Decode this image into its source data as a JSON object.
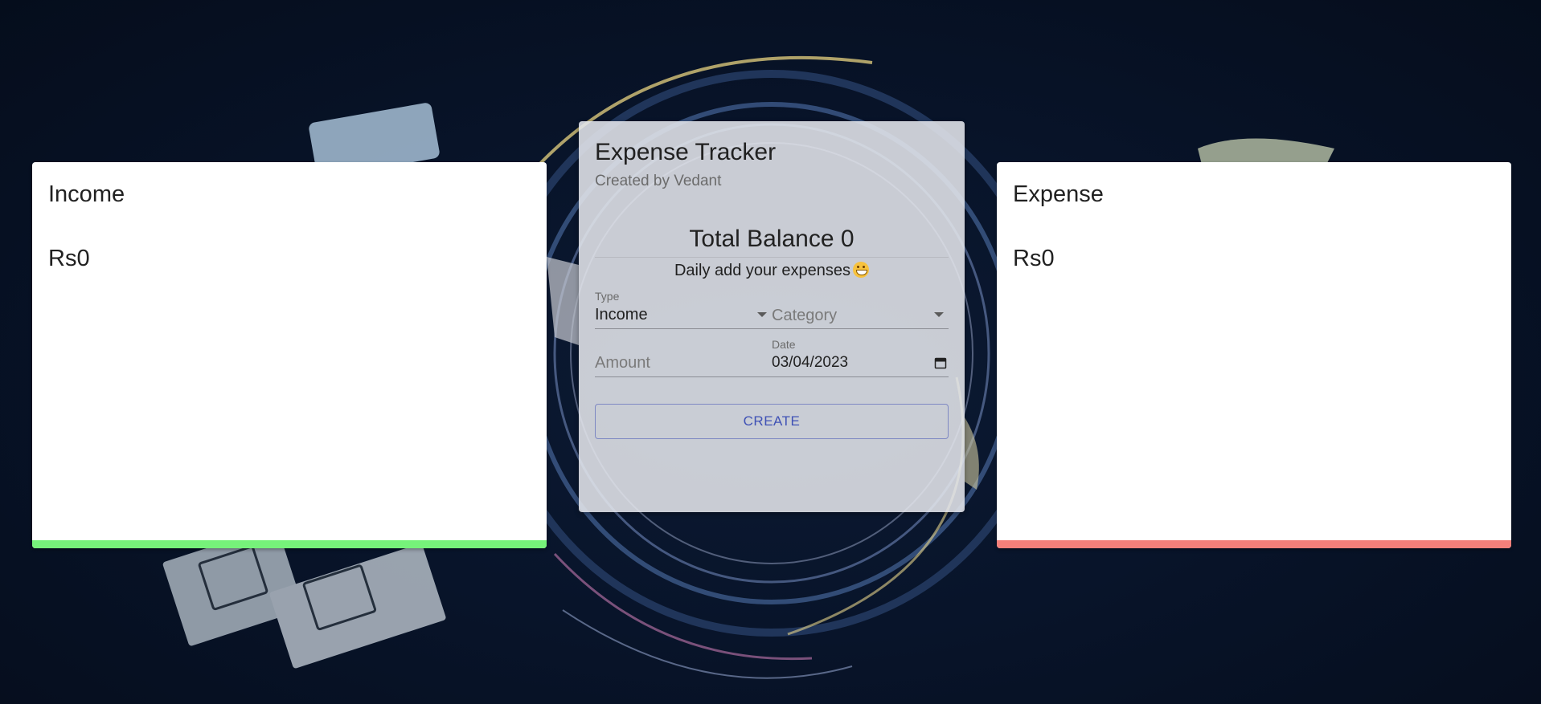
{
  "theme": {
    "income_color": "#76f27a",
    "expense_color": "#f47f7a",
    "accent_color": "#3f51b5"
  },
  "income_card": {
    "title": "Income",
    "amount": "Rs0"
  },
  "expense_card": {
    "title": "Expense",
    "amount": "Rs0"
  },
  "tracker": {
    "title": "Expense Tracker",
    "subtitle": "Created by Vedant",
    "balance": "Total Balance 0",
    "tagline": "Daily add your expenses",
    "tagline_emoji": "grinning-face-icon",
    "form": {
      "type_label": "Type",
      "type_value": "Income",
      "category_placeholder": "Category",
      "amount_placeholder": "Amount",
      "date_label": "Date",
      "date_value": "03/04/2023",
      "create_label": "CREATE"
    }
  }
}
